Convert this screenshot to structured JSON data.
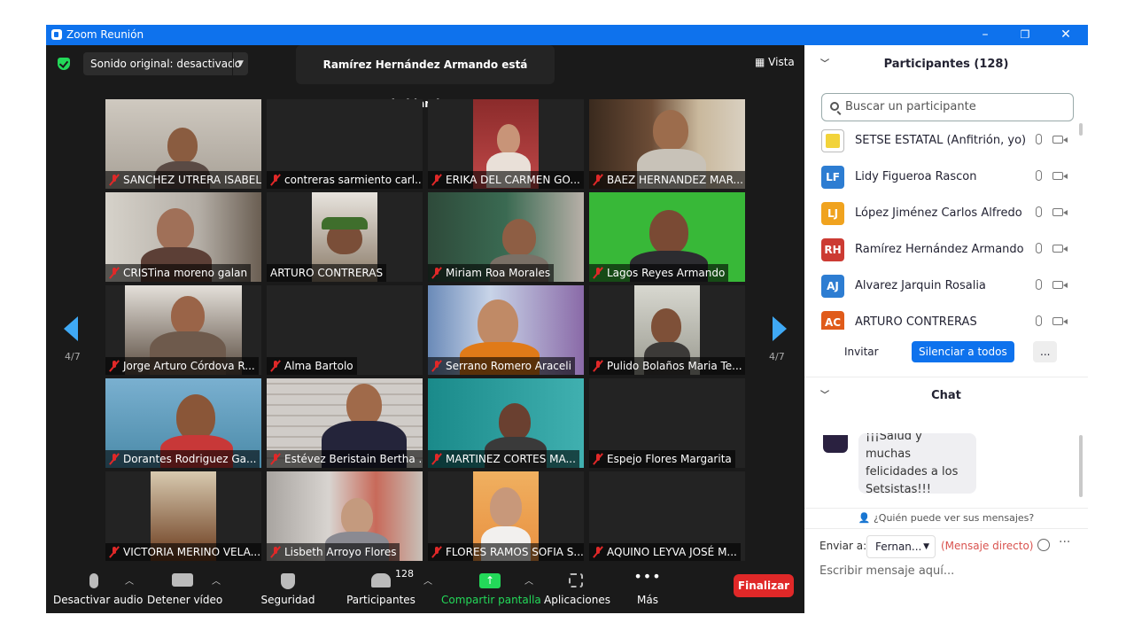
{
  "window": {
    "title": "Zoom Reunión"
  },
  "top": {
    "original_sound": "Sonido original: desactivado",
    "speaking": "Ramírez Hernández Armando está hablando...",
    "view": "Vista"
  },
  "tiles": [
    {
      "name": "SANCHEZ UTRERA ISABEL",
      "muted": true
    },
    {
      "name": "contreras sarmiento carl...",
      "muted": true
    },
    {
      "name": "ERIKA DEL CARMEN GO...",
      "muted": true
    },
    {
      "name": "BAEZ HERNANDEZ MAR...",
      "muted": true
    },
    {
      "name": "CRISTina moreno galan",
      "muted": true
    },
    {
      "name": "ARTURO CONTRERAS",
      "muted": false
    },
    {
      "name": "Miriam Roa Morales",
      "muted": true
    },
    {
      "name": "Lagos Reyes Armando",
      "muted": true
    },
    {
      "name": "Jorge Arturo Córdova R...",
      "muted": true
    },
    {
      "name": "Alma Bartolo",
      "muted": true
    },
    {
      "name": "Serrano Romero Araceli",
      "muted": true
    },
    {
      "name": "Pulido Bolaños Maria Te...",
      "muted": true
    },
    {
      "name": "Dorantes Rodriguez Ga...",
      "muted": true
    },
    {
      "name": "Estévez Beristain Bertha ...",
      "muted": true
    },
    {
      "name": "MARTINEZ CORTES MA...",
      "muted": true
    },
    {
      "name": "Espejo Flores Margarita",
      "muted": true
    },
    {
      "name": "VICTORIA MERINO VELA...",
      "muted": true
    },
    {
      "name": "Lisbeth Arroyo Flores",
      "muted": true
    },
    {
      "name": "FLORES RAMOS SOFIA S...",
      "muted": true
    },
    {
      "name": "AQUINO LEYVA JOSÉ M...",
      "muted": true
    }
  ],
  "pagination": {
    "left": "4/7",
    "right": "4/7"
  },
  "toolbar": {
    "audio": "Desactivar audio",
    "video": "Detener vídeo",
    "security": "Seguridad",
    "participants": "Participantes",
    "participants_count": "128",
    "share": "Compartir pantalla",
    "apps": "Aplicaciones",
    "more": "Más",
    "end": "Finalizar"
  },
  "participants_panel": {
    "title": "Participantes (128)",
    "search_placeholder": "Buscar un participante",
    "list": [
      {
        "initials": "",
        "name": "SETSE ESTATAL (Anfitrión, yo)",
        "color": "#f2d33a"
      },
      {
        "initials": "LF",
        "name": "Lidy Figueroa Rascon",
        "color": "#2d7dd2"
      },
      {
        "initials": "LJ",
        "name": "López Jiménez Carlos Alfredo",
        "color": "#f0a31f"
      },
      {
        "initials": "RH",
        "name": "Ramírez Hernández Armando",
        "color": "#cc3b33"
      },
      {
        "initials": "AJ",
        "name": "Alvarez Jarquin Rosalia",
        "color": "#2d7dd2"
      },
      {
        "initials": "AC",
        "name": "ARTURO CONTRERAS",
        "color": "#e05b1a"
      }
    ],
    "invite": "Invitar",
    "mute_all": "Silenciar a todos",
    "more": "..."
  },
  "chat": {
    "title": "Chat",
    "message": "¡¡¡Salud y muchas felicidades a los Setsistas!!!",
    "who_can_see": "¿Quién puede ver sus mensajes?",
    "send_to_label": "Enviar a:",
    "recipient": "Fernan...",
    "direct": "(Mensaje directo)",
    "placeholder": "Escribir mensaje aquí..."
  },
  "colors": {
    "accent": "#0e72ed",
    "end": "#e02828",
    "share": "#23d959"
  }
}
